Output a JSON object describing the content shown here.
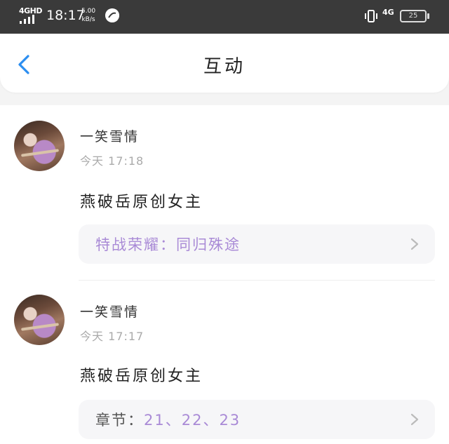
{
  "status_bar": {
    "network": "4GHD",
    "time": "18:17",
    "speed_value": "5.00",
    "speed_unit": "kB/s",
    "right_network": "4G",
    "battery": "25"
  },
  "header": {
    "title": "互动"
  },
  "comments": [
    {
      "username": "一笑雪情",
      "time": "今天 17:18",
      "text": "燕破岳原创女主",
      "card_prefix": "特战荣耀：",
      "card_value": "同归殊途"
    },
    {
      "username": "一笑雪情",
      "time": "今天 17:17",
      "text": "燕破岳原创女主",
      "card_prefix": "章节：",
      "card_value": "21、22、23"
    }
  ],
  "colors": {
    "accent_blue": "#2b8ef0",
    "link_purple": "#a98ad6",
    "prefix_dark": "#555555"
  }
}
